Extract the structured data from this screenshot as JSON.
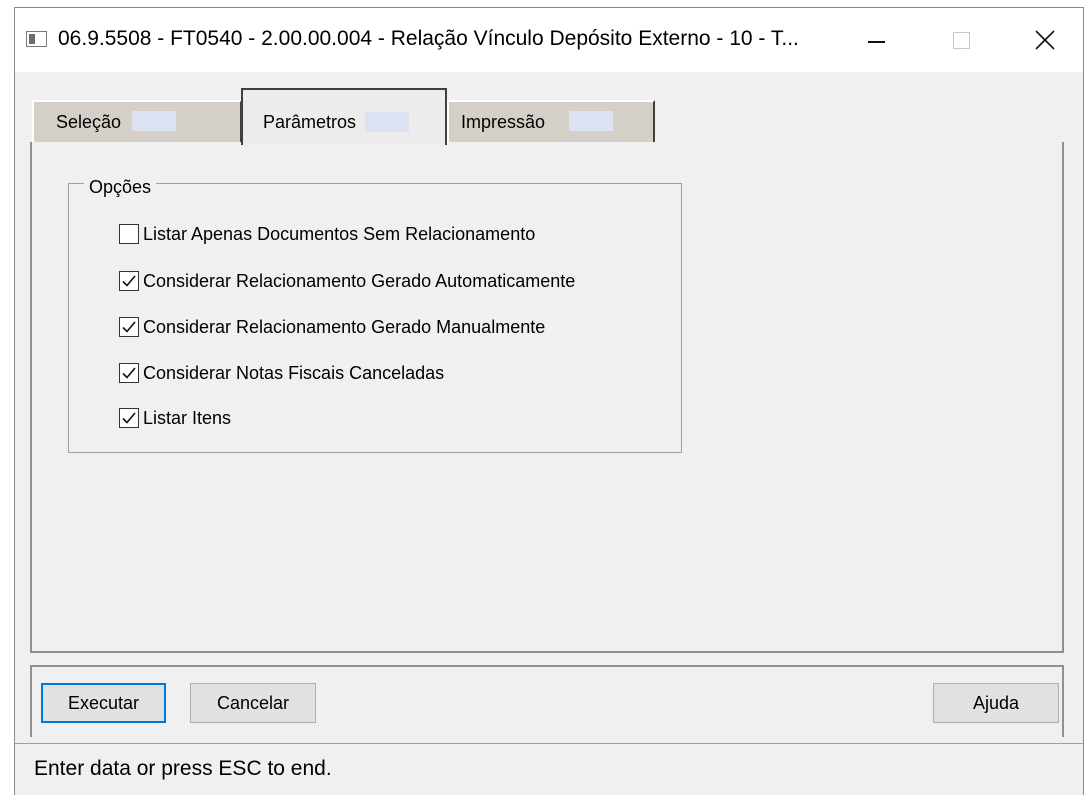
{
  "window": {
    "title": "06.9.5508 - FT0540 - 2.00.00.004 - Relação Vínculo Depósito Externo - 10 - T..."
  },
  "tabs": [
    {
      "label": "Seleção",
      "active": false
    },
    {
      "label": "Parâmetros",
      "active": true
    },
    {
      "label": "Impressão",
      "active": false
    }
  ],
  "options_group": {
    "legend": "Opções",
    "options": [
      {
        "label": "Listar Apenas Documentos Sem Relacionamento",
        "checked": false
      },
      {
        "label": "Considerar Relacionamento Gerado Automaticamente",
        "checked": true
      },
      {
        "label": "Considerar Relacionamento Gerado Manualmente",
        "checked": true
      },
      {
        "label": "Considerar Notas Fiscais Canceladas",
        "checked": true
      },
      {
        "label": "Listar Itens",
        "checked": true
      }
    ]
  },
  "buttons": {
    "executar": "Executar",
    "cancelar": "Cancelar",
    "ajuda": "Ajuda"
  },
  "status": {
    "text": "Enter data or press ESC to end."
  },
  "icons": {
    "app": "app-window-icon",
    "minimize": "minimize-icon",
    "maximize": "maximize-icon",
    "close": "close-icon",
    "check": "checkmark-icon"
  },
  "colors": {
    "default_button_border": "#0078d7",
    "tab_label_highlight": "#dde2f2",
    "dialog_background": "#f0f0f0"
  }
}
